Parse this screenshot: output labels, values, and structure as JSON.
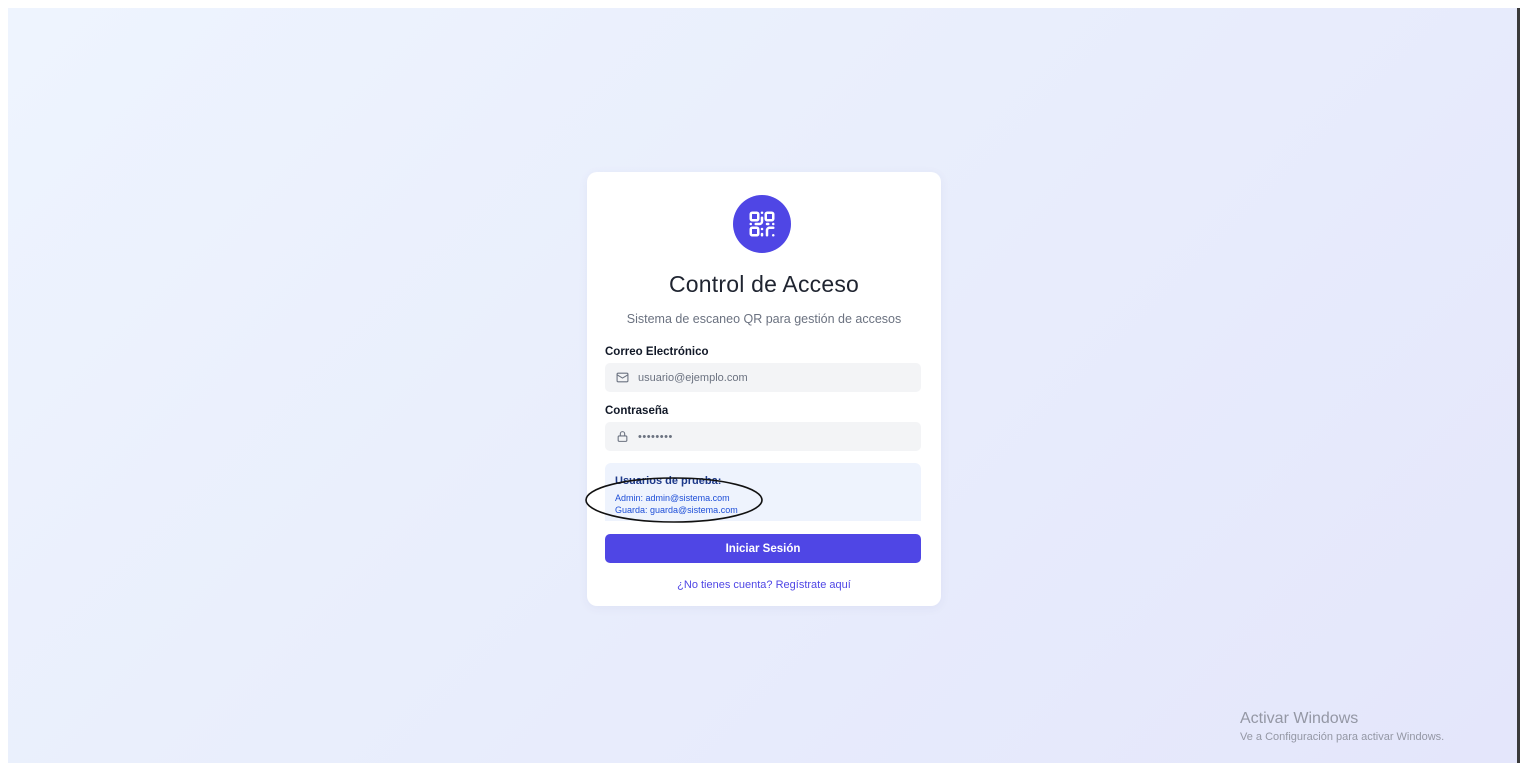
{
  "login": {
    "logo_icon": "qr-code-icon",
    "title": "Control de Acceso",
    "subtitle": "Sistema de escaneo QR para gestión de accesos",
    "email": {
      "label": "Correo Electrónico",
      "placeholder": "usuario@ejemplo.com",
      "icon": "mail-icon"
    },
    "password": {
      "label": "Contraseña",
      "value": "••••••••",
      "icon": "lock-icon"
    },
    "test_users": {
      "title": "Usuarios de prueba:",
      "admin": "Admin: admin@sistema.com",
      "guard": "Guarda: guarda@sistema.com"
    },
    "submit_label": "Iniciar Sesión",
    "register_link": "¿No tienes cuenta? Regístrate aquí"
  },
  "watermark": {
    "title": "Activar Windows",
    "subtitle": "Ve a Configuración para activar Windows."
  },
  "colors": {
    "accent": "#4f46e5",
    "test_box_bg": "#eef3fd",
    "test_box_title": "#1e3a8a"
  }
}
